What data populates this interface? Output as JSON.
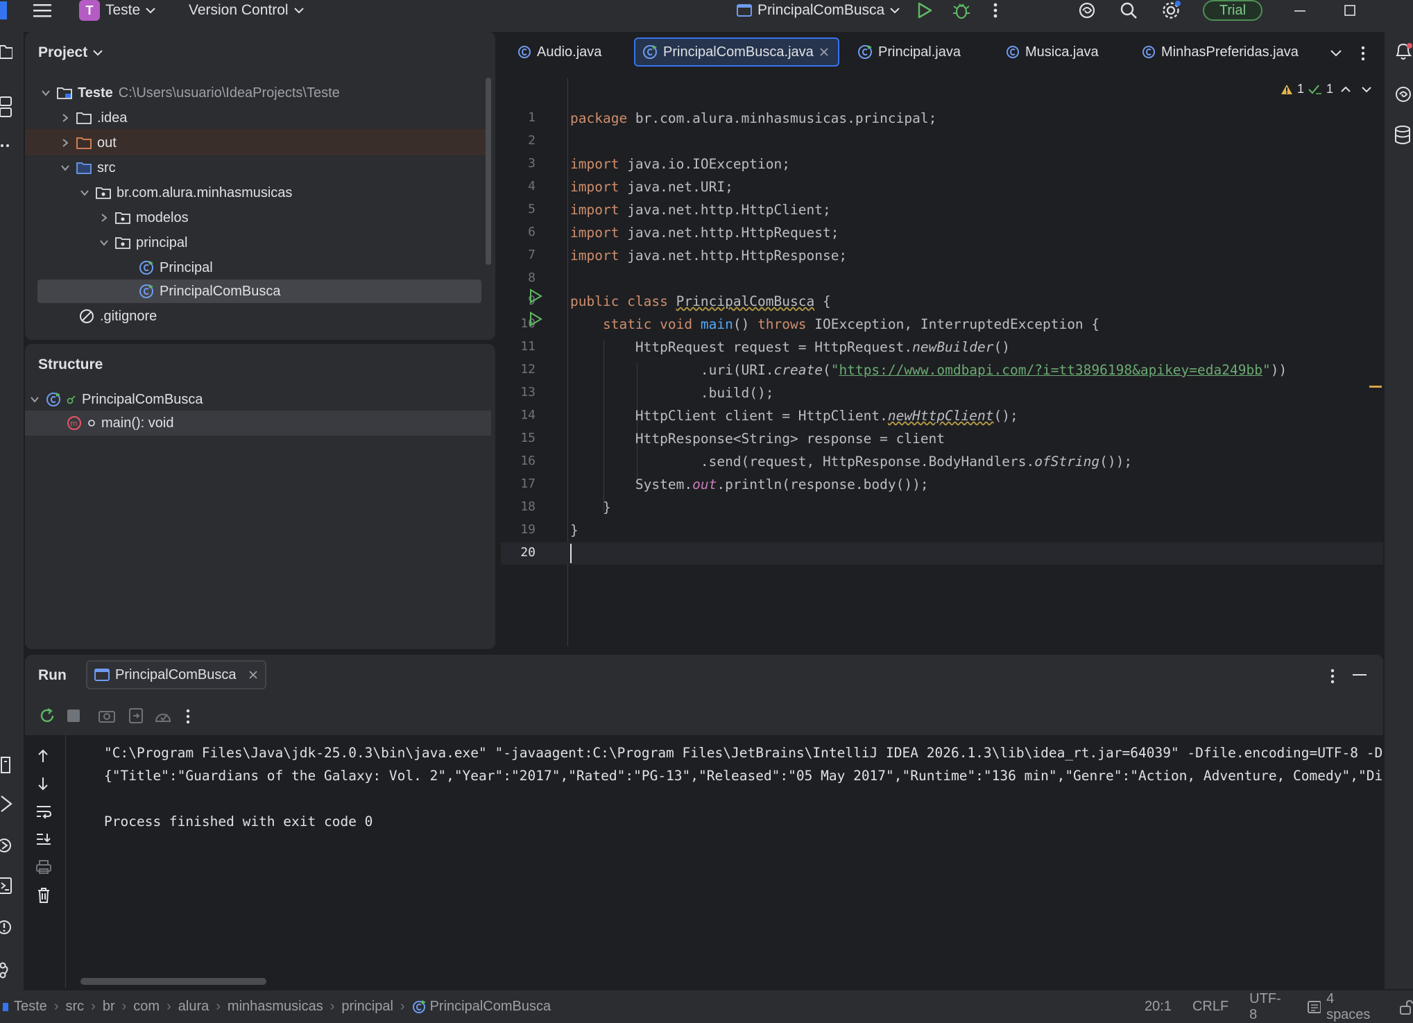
{
  "titlebar": {
    "project_badge": "T",
    "project_name": "Teste",
    "vcs_label": "Version Control",
    "run_config": "PrincipalComBusca",
    "trial_label": "Trial"
  },
  "project_panel": {
    "title": "Project",
    "tree": [
      {
        "label": "Teste",
        "path": "C:\\Users\\usuario\\IdeaProjects\\Teste"
      },
      {
        "label": ".idea"
      },
      {
        "label": "out"
      },
      {
        "label": "src"
      },
      {
        "label": "br.com.alura.minhasmusicas"
      },
      {
        "label": "modelos"
      },
      {
        "label": "principal"
      },
      {
        "label": "Principal"
      },
      {
        "label": "PrincipalComBusca"
      },
      {
        "label": ".gitignore"
      }
    ]
  },
  "structure_panel": {
    "title": "Structure",
    "class_name": "PrincipalComBusca",
    "method": "main(): void"
  },
  "editor": {
    "tabs": [
      {
        "label": "Audio.java"
      },
      {
        "label": "PrincipalComBusca.java"
      },
      {
        "label": "Principal.java"
      },
      {
        "label": "Musica.java"
      },
      {
        "label": "MinhasPreferidas.java"
      }
    ],
    "warnings": "1",
    "checks": "1",
    "line_numbers": [
      "1",
      "2",
      "3",
      "4",
      "5",
      "6",
      "7",
      "8",
      "9",
      "10",
      "11",
      "12",
      "13",
      "14",
      "15",
      "16",
      "17",
      "18",
      "19",
      "20"
    ],
    "code": {
      "l1_kw": "package",
      "l1_rest": " br.com.alura.minhasmusicas.principal;",
      "import_kw": "import",
      "l3": " java.io.IOException;",
      "l4": " java.net.URI;",
      "l5": " java.net.http.HttpClient;",
      "l6": " java.net.http.HttpRequest;",
      "l7": " java.net.http.HttpResponse;",
      "l9_kw": "public class",
      "l9_name": "PrincipalComBusca",
      "l9_end": " {",
      "l10_kw": "static void",
      "l10_fn": "main",
      "l10_mid": "() ",
      "l10_throws": "throws",
      "l10_rest": " IOException, InterruptedException {",
      "l11_a": "HttpRequest request = HttpRequest.",
      "l11_it": "newBuilder",
      "l11_b": "()",
      "l12_a": ".uri(URI.",
      "l12_it": "create",
      "l12_b": "(",
      "l12_q1": "\"",
      "l12_url": "https://www.omdbapi.com/?i=tt3896198&apikey=eda249bb",
      "l12_q2": "\"",
      "l12_c": "))",
      "l13": ".build();",
      "l14_a": "HttpClient client = HttpClient.",
      "l14_it": "newHttpClient",
      "l14_b": "();",
      "l15": "HttpResponse<String> response = client",
      "l16_a": ".send(request, HttpResponse.BodyHandlers.",
      "l16_it": "ofString",
      "l16_b": "());",
      "l17_a": "System.",
      "l17_it": "out",
      "l17_b": ".println(response.body());",
      "l18": "}",
      "l19": "}"
    }
  },
  "run_panel": {
    "title": "Run",
    "tab_label": "PrincipalComBusca",
    "console": [
      "\"C:\\Program Files\\Java\\jdk-25.0.3\\bin\\java.exe\" \"-javaagent:C:\\Program Files\\JetBrains\\IntelliJ IDEA 2026.1.3\\lib\\idea_rt.jar=64039\" -Dfile.encoding=UTF-8 -D",
      "{\"Title\":\"Guardians of the Galaxy: Vol. 2\",\"Year\":\"2017\",\"Rated\":\"PG-13\",\"Released\":\"05 May 2017\",\"Runtime\":\"136 min\",\"Genre\":\"Action, Adventure, Comedy\",\"Di",
      "",
      "Process finished with exit code 0"
    ]
  },
  "statusbar": {
    "breadcrumbs": [
      "Teste",
      "src",
      "br",
      "com",
      "alura",
      "minhasmusicas",
      "principal",
      "PrincipalComBusca"
    ],
    "position": "20:1",
    "line_sep": "CRLF",
    "encoding": "UTF-8",
    "indent": "4 spaces"
  }
}
